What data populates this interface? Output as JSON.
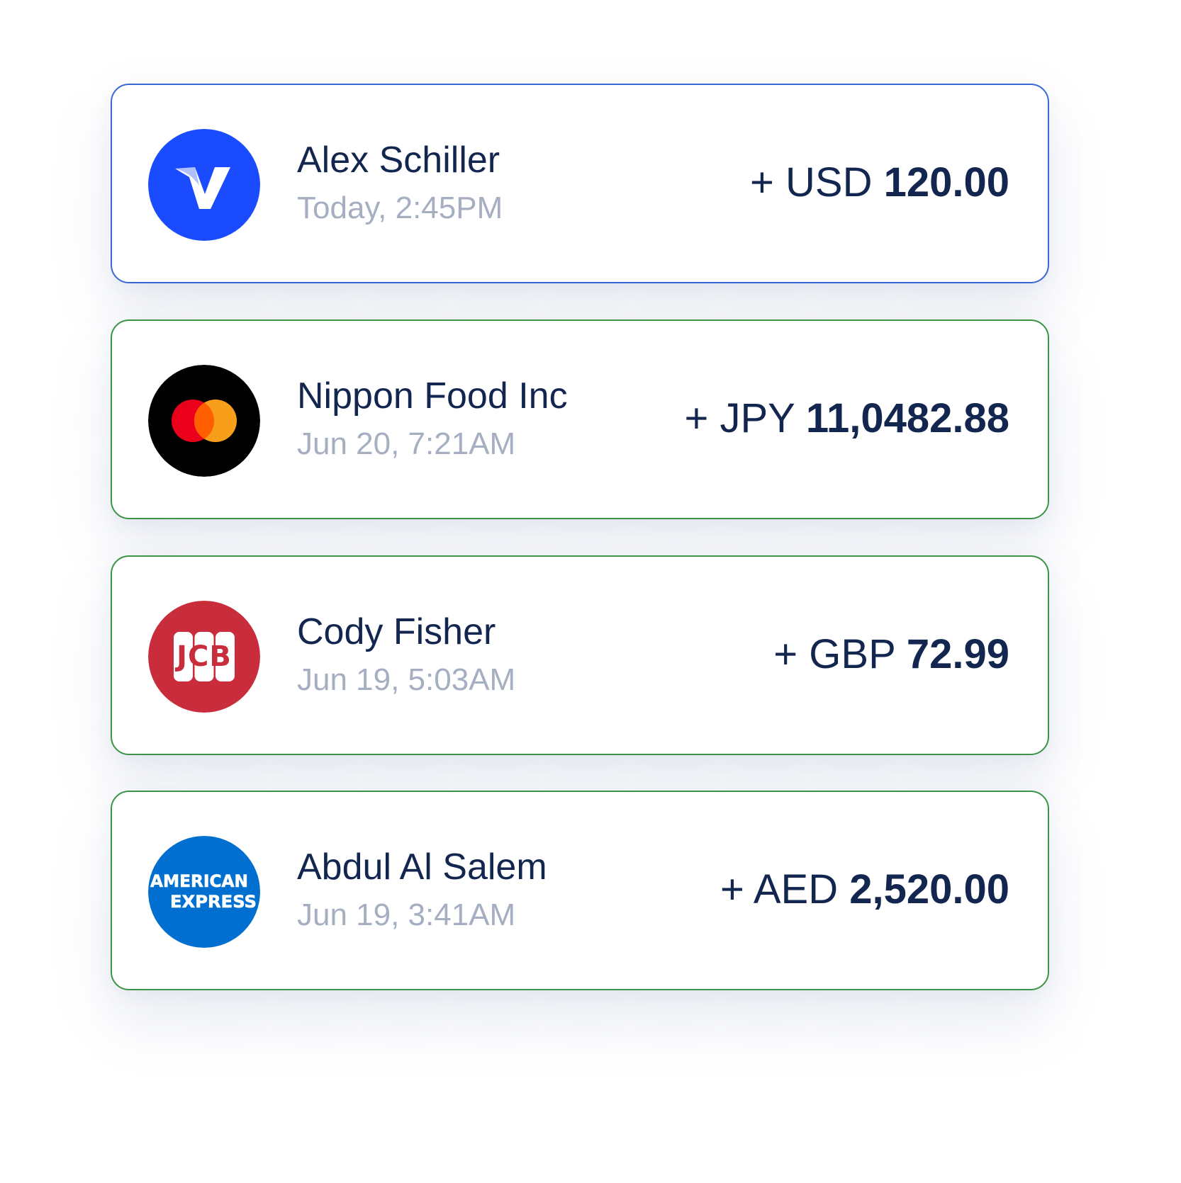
{
  "transactions": [
    {
      "name": "Alex Schiller",
      "time": "Today, 2:45PM",
      "sign": "+",
      "currency": "USD",
      "amount": "120.00",
      "card_icon": "visa-card-icon",
      "selected": true
    },
    {
      "name": "Nippon Food Inc",
      "time": "Jun 20, 7:21AM",
      "sign": "+",
      "currency": "JPY",
      "amount": "11,0482.88",
      "card_icon": "mastercard-icon",
      "selected": false
    },
    {
      "name": "Cody Fisher",
      "time": "Jun 19, 5:03AM",
      "sign": "+",
      "currency": "GBP",
      "amount": "72.99",
      "card_icon": "jcb-card-icon",
      "logo_text": "JCB",
      "selected": false
    },
    {
      "name": "Abdul Al Salem",
      "time": "Jun 19, 3:41AM",
      "sign": "+",
      "currency": "AED",
      "amount": "2,520.00",
      "card_icon": "american-express-icon",
      "logo_text": [
        "AMERICAN",
        "EXPRESS"
      ],
      "selected": false
    }
  ],
  "colors": {
    "selected_border": "#3a67d6",
    "card_border": "#3b9446",
    "text_primary": "#12264f",
    "text_secondary": "#a6aec1",
    "visa_blue": "#1a4bff",
    "mastercard_red": "#eb001b",
    "mastercard_orange": "#f79e1b",
    "jcb_red": "#c92d3c",
    "amex_blue": "#006fcf"
  }
}
